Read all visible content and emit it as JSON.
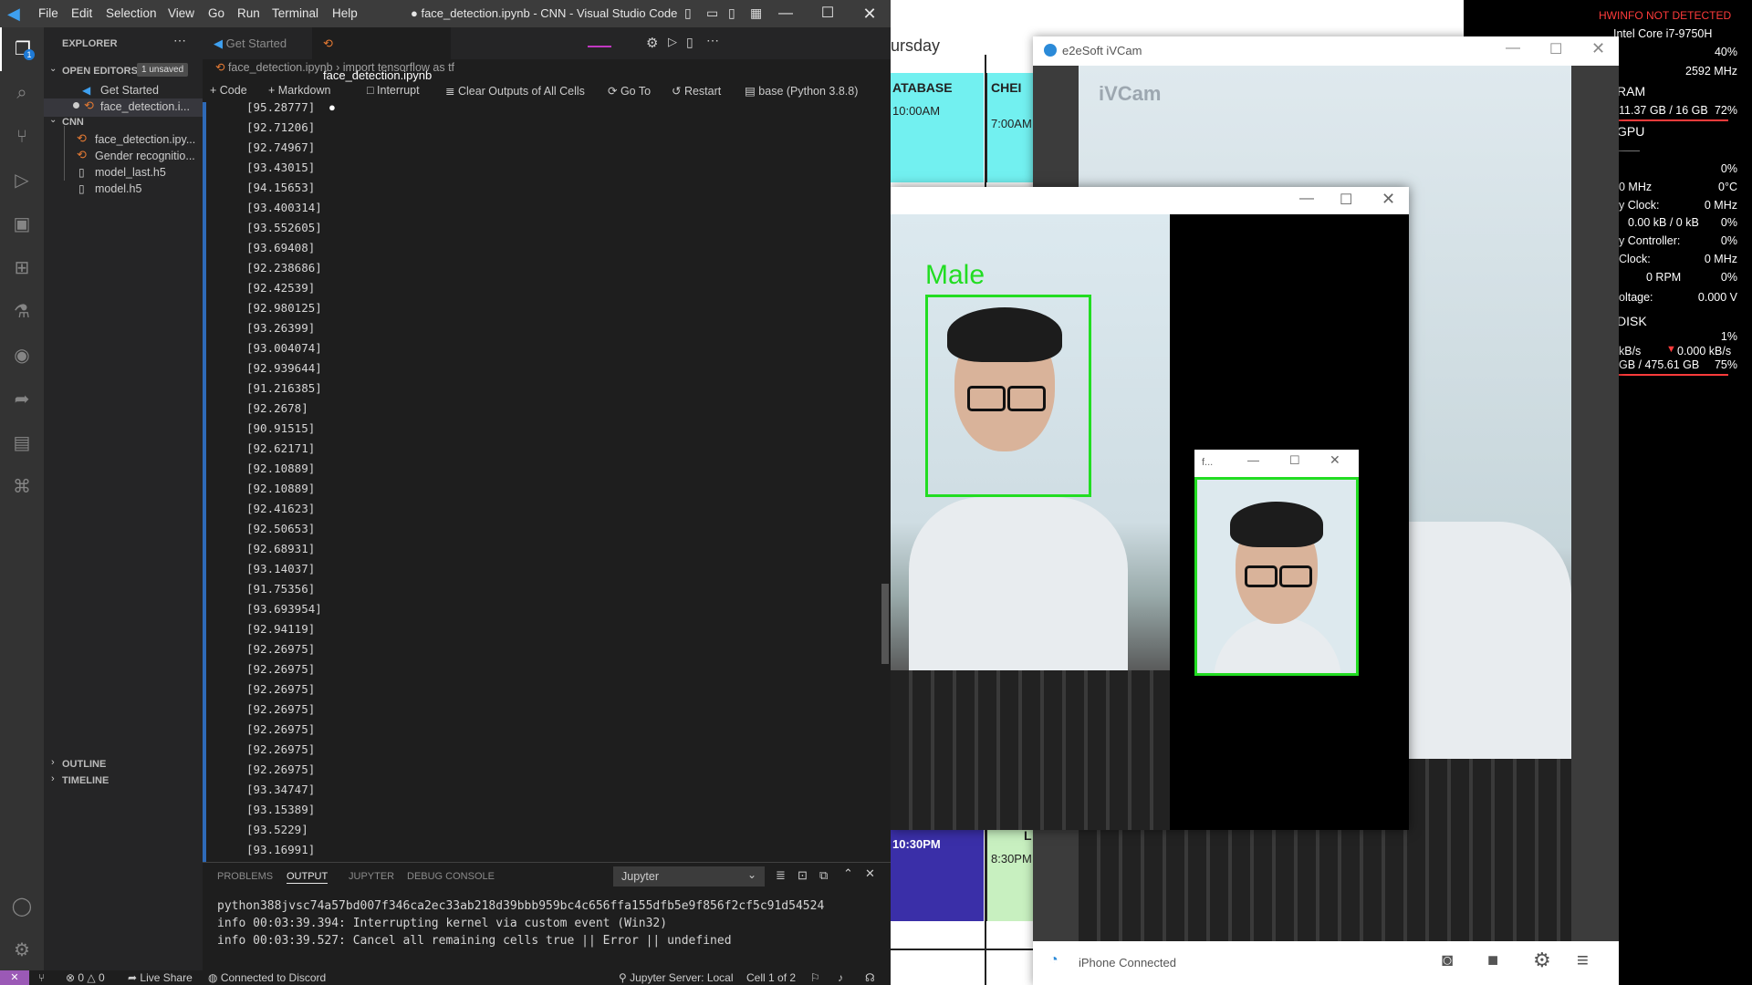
{
  "vscode": {
    "menu": [
      "File",
      "Edit",
      "Selection",
      "View",
      "Go",
      "Run",
      "Terminal",
      "Help"
    ],
    "window_title": "● face_detection.ipynb - CNN - Visual Studio Code",
    "explorer": {
      "title": "EXPLORER",
      "open_editors": "OPEN EDITORS",
      "unsaved_badge": "1 unsaved",
      "open_files": [
        "Get Started",
        "face_detection.i..."
      ],
      "folder": "CNN",
      "files": [
        "face_detection.ipy...",
        "Gender recognitio...",
        "model_last.h5",
        "model.h5"
      ],
      "outline": "OUTLINE",
      "timeline": "TIMELINE"
    },
    "tabs": [
      "Get Started",
      "face_detection.ipynb"
    ],
    "breadcrumb": [
      "face_detection.ipynb",
      "import tensorflow as tf"
    ],
    "notebook_toolbar": [
      "Code",
      "Markdown",
      "Interrupt",
      "Clear Outputs of All Cells",
      "Go To",
      "Restart"
    ],
    "kernel": "base (Python 3.8.8)",
    "output_lines": [
      "[95.28777]",
      "[92.71206]",
      "[92.74967]",
      "[93.43015]",
      "[94.15653]",
      "[93.400314]",
      "[93.552605]",
      "[93.69408]",
      "[92.238686]",
      "[92.42539]",
      "[92.980125]",
      "[93.26399]",
      "[93.004074]",
      "[92.939644]",
      "[91.216385]",
      "[92.2678]",
      "[90.91515]",
      "[92.62171]",
      "[92.10889]",
      "[92.10889]",
      "[92.41623]",
      "[92.50653]",
      "[92.68931]",
      "[93.14037]",
      "[91.75356]",
      "[93.693954]",
      "[92.94119]",
      "[92.26975]",
      "[92.26975]",
      "[92.26975]",
      "[92.26975]",
      "[92.26975]",
      "[92.26975]",
      "[92.26975]",
      "[93.34747]",
      "[93.15389]",
      "[93.5229]",
      "[93.16991]"
    ],
    "panel": {
      "tabs": [
        "PROBLEMS",
        "OUTPUT",
        "JUPYTER",
        "DEBUG CONSOLE"
      ],
      "channel": "Jupyter",
      "log": [
        "python388jvsc74a57bd007f346ca2ec33ab218d39bbb959bc4c656ffa155dfb5e9f856f2cf5c91d54524",
        "info 00:03:39.394: Interrupting kernel via custom event (Win32)",
        "info 00:03:39.527: Cancel all remaining cells true || Error || undefined"
      ]
    },
    "status": {
      "errors": "0",
      "warnings": "0",
      "live_share": "Live Share",
      "discord": "Connected to Discord",
      "jupyter_server": "Jupyter Server: Local",
      "cell": "Cell 1 of 2"
    }
  },
  "calendar": {
    "day": "ursday",
    "headers": [
      "ATABASE",
      "CHEI"
    ],
    "times_top": [
      "10:00AM",
      "7:00AM"
    ],
    "times_bottom": [
      "10:30PM",
      "8:30PM"
    ],
    "bottom_header": "L"
  },
  "ivcam": {
    "title": "e2eSoft iVCam",
    "watermark": "iVCam",
    "status": "iPhone Connected"
  },
  "face_window": {
    "label": "Male",
    "small_title": "f..."
  },
  "hwinfo": {
    "warning": "HWINFO NOT DETECTED",
    "cpu": "Intel Core i7-9750H",
    "cpu_usage": "40%",
    "cpu_clock": "2592 MHz",
    "ram_title": "RAM",
    "ram_value": "11.37 GB / 16 GB",
    "ram_pct": "72%",
    "gpu_title": "GPU",
    "gpu_sep": "——",
    "gpu_usage": "0%",
    "gpu_rows": [
      {
        "label": "0 MHz",
        "value": "0°C"
      },
      {
        "label": "y Clock:",
        "value": "0 MHz"
      },
      {
        "label": "0.00 kB / 0 kB",
        "value": "0%"
      },
      {
        "label": "y Controller:",
        "value": "0%"
      },
      {
        "label": "Clock:",
        "value": "0 MHz"
      },
      {
        "label": "0 RPM",
        "value": "0%"
      },
      {
        "label": "oltage:",
        "value": "0.000 V"
      }
    ],
    "disk_title": "DISK",
    "disk_usage": "1%",
    "disk_rw_left": "kB/s",
    "disk_rw_right": "0.000 kB/s",
    "disk_space": "GB / 475.61 GB",
    "disk_pct": "75%",
    "accent": "#ff3b3b"
  }
}
